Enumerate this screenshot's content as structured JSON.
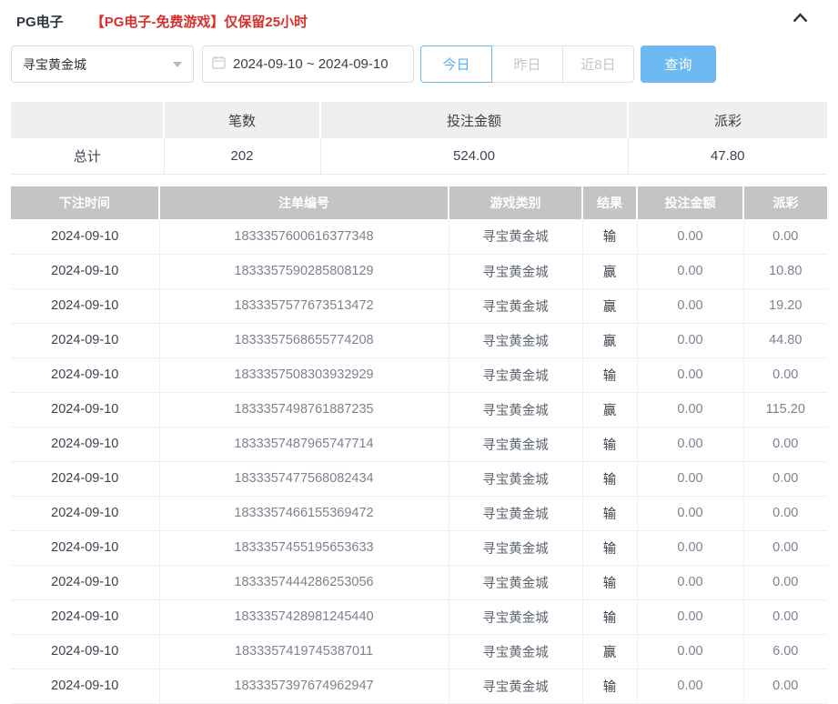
{
  "header": {
    "title": "PG电子",
    "notice": "【PG电子-免费游戏】仅保留25小时",
    "collapse_icon": "chevron-up-icon"
  },
  "filters": {
    "game_select": {
      "value": "寻宝黄金城",
      "icon": "caret-down-icon"
    },
    "date_range": {
      "value": "2024-09-10 ~ 2024-09-10",
      "icon": "calendar-icon"
    },
    "quick_buttons": [
      {
        "label": "今日",
        "active": true
      },
      {
        "label": "昨日",
        "active": false
      },
      {
        "label": "近8日",
        "active": false
      }
    ],
    "search_label": "查询"
  },
  "summary": {
    "columns": [
      "",
      "笔数",
      "投注金额",
      "派彩"
    ],
    "row_label": "总计",
    "count": "202",
    "bet_amount": "524.00",
    "payout": "47.80"
  },
  "table": {
    "columns": [
      "下注时间",
      "注单编号",
      "游戏类别",
      "结果",
      "投注金额",
      "派彩"
    ],
    "rows": [
      [
        "2024-09-10",
        "1833357600616377348",
        "寻宝黄金城",
        "输",
        "0.00",
        "0.00"
      ],
      [
        "2024-09-10",
        "1833357590285808129",
        "寻宝黄金城",
        "赢",
        "0.00",
        "10.80"
      ],
      [
        "2024-09-10",
        "1833357577673513472",
        "寻宝黄金城",
        "赢",
        "0.00",
        "19.20"
      ],
      [
        "2024-09-10",
        "1833357568655774208",
        "寻宝黄金城",
        "赢",
        "0.00",
        "44.80"
      ],
      [
        "2024-09-10",
        "1833357508303932929",
        "寻宝黄金城",
        "输",
        "0.00",
        "0.00"
      ],
      [
        "2024-09-10",
        "1833357498761887235",
        "寻宝黄金城",
        "赢",
        "0.00",
        "115.20"
      ],
      [
        "2024-09-10",
        "1833357487965747714",
        "寻宝黄金城",
        "输",
        "0.00",
        "0.00"
      ],
      [
        "2024-09-10",
        "1833357477568082434",
        "寻宝黄金城",
        "输",
        "0.00",
        "0.00"
      ],
      [
        "2024-09-10",
        "1833357466155369472",
        "寻宝黄金城",
        "输",
        "0.00",
        "0.00"
      ],
      [
        "2024-09-10",
        "1833357455195653633",
        "寻宝黄金城",
        "输",
        "0.00",
        "0.00"
      ],
      [
        "2024-09-10",
        "1833357444286253056",
        "寻宝黄金城",
        "输",
        "0.00",
        "0.00"
      ],
      [
        "2024-09-10",
        "1833357428981245440",
        "寻宝黄金城",
        "输",
        "0.00",
        "0.00"
      ],
      [
        "2024-09-10",
        "1833357419745387011",
        "寻宝黄金城",
        "赢",
        "0.00",
        "6.00"
      ],
      [
        "2024-09-10",
        "1833357397674962947",
        "寻宝黄金城",
        "输",
        "0.00",
        "0.00"
      ]
    ]
  },
  "colors": {
    "accent_blue": "#6db9f2",
    "notice_red": "#d9302c",
    "data_header_bg": "#c4c4c4",
    "summary_header_bg": "#efefef"
  }
}
